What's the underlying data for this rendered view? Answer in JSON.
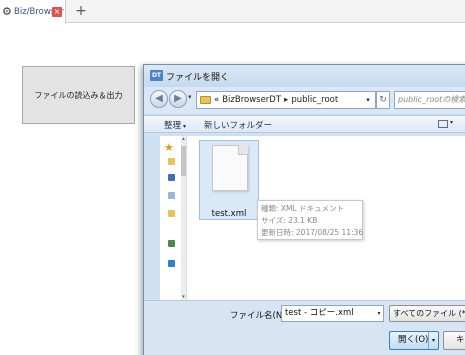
{
  "app": {
    "tab_title": "Biz/Browser",
    "tab_close": "×",
    "new_tab": "+",
    "action_button": "ファイルの読込み＆出力"
  },
  "dialog": {
    "icon_text": "DT",
    "title": "ファイルを開く",
    "nav": {
      "back": "◀",
      "forward": "▶",
      "history": "▾"
    },
    "address": {
      "prefix": "«",
      "segments": [
        "BizBrowserDT",
        "public_root"
      ],
      "separator": "▸",
      "dropdown": "▾"
    },
    "refresh": "↻",
    "search_placeholder": "public_rootの検索",
    "commands": {
      "organize": "整理",
      "organize_arrow": "▾",
      "new_folder": "新しいフォルダー",
      "view_dropdown": "▾"
    },
    "navpane": {
      "star": "★",
      "icon_colors": [
        "#e8c25b",
        "#3f6fb5",
        "#9ab7d9",
        "#e8c25b",
        "#4a8a4a",
        "#2f7fcf"
      ]
    },
    "files": [
      {
        "name": "test.xml"
      }
    ],
    "tooltip": {
      "type": "種類: XML ドキュメント",
      "size": "サイズ: 23.1 KB",
      "modified": "更新日時: 2017/08/25 11:36"
    },
    "footer": {
      "filename_label": "ファイル名(N):",
      "filename_value": "test - コピー.xml",
      "filename_dropdown": "▾",
      "filter": "すべてのファイル (*",
      "open_button": "開く(O)",
      "open_dropdown": "▾",
      "cancel_button": "キャンセル"
    }
  }
}
